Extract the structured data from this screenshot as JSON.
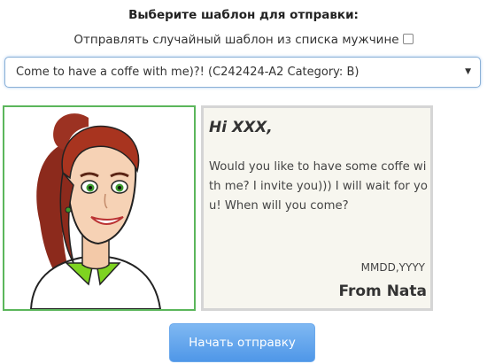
{
  "header": {
    "title": "Выберите шаблон для отправки:",
    "random_label": "Отправлять случайный шаблон из списка мужчине",
    "random_checked": false
  },
  "template_select": {
    "value": "Come to have a coffe with me)?! (C242424-A2 Category: B)"
  },
  "letter": {
    "greeting": "Hi XXX,",
    "body": "Would you like to have some coffe with me? I invite you))) I will wait for you! When will you come?",
    "date": "MMDD,YYYY",
    "signature": "From Nata"
  },
  "actions": {
    "start_label": "Начать отправку"
  },
  "colors": {
    "photo_border": "#5bb65b",
    "button": "#5a9fe8",
    "letter_bg": "#f7f6ef"
  }
}
